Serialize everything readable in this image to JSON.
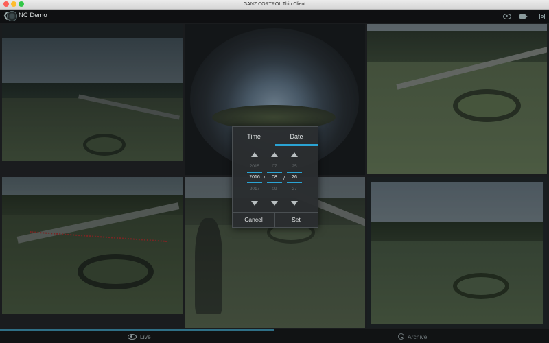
{
  "window": {
    "title": "GANZ CORTROL Thin Client"
  },
  "header": {
    "title": "NC Demo",
    "icons": [
      "back-icon",
      "logo-icon",
      "eye-icon",
      "camera-icon",
      "layout-icon",
      "snapshot-icon"
    ]
  },
  "colors": {
    "accent": "#2aa3d3",
    "background": "#1a1c1e",
    "header": "#0f1012"
  },
  "date_picker": {
    "tab_time": "Time",
    "tab_date": "Date",
    "active_tab": "Date",
    "year": {
      "prev": "2015",
      "current": "2016",
      "next": "2017"
    },
    "month": {
      "prev": "07",
      "current": "08",
      "next": "09"
    },
    "day": {
      "prev": "25",
      "current": "26",
      "next": "27"
    },
    "separator": "/",
    "cancel_label": "Cancel",
    "set_label": "Set"
  },
  "bottom": {
    "live_label": "Live",
    "archive_label": "Archive",
    "active_mode": "Live"
  }
}
